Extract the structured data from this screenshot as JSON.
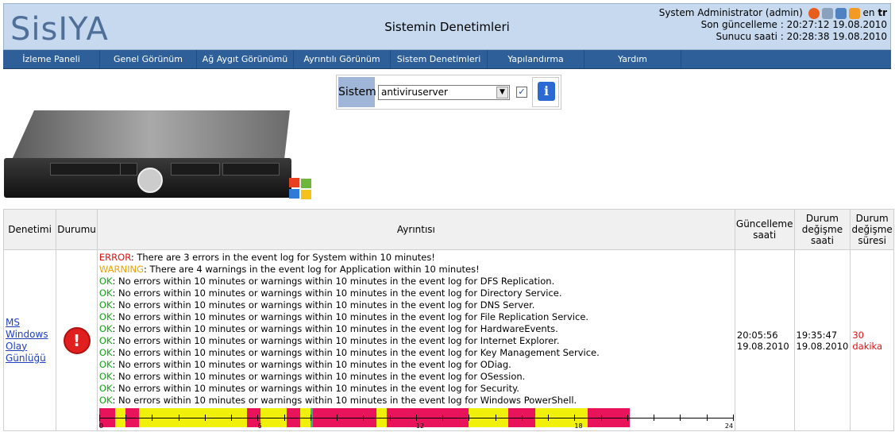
{
  "header": {
    "logo": "SisIYA",
    "title": "Sistemin Denetimleri",
    "user": "System Administrator (admin)",
    "lang_en": "en",
    "lang_tr": "tr",
    "last_update": "Son güncelleme : 20:27:12 19.08.2010",
    "server_time": "Sunucu saati : 20:28:38 19.08.2010",
    "icons": [
      "power-icon",
      "tools-icon",
      "download-icon",
      "rss-icon"
    ]
  },
  "menu": [
    "İzleme Paneli",
    "Genel Görünüm",
    "Ağ Aygıt Görünümü",
    "Ayrıntılı Görünüm",
    "Sistem Denetimleri",
    "Yapılandırma",
    "Yardım"
  ],
  "selector": {
    "label": "Sistem",
    "value": "antiviruserver",
    "checkbox_checked": true,
    "info_icon": "info-icon"
  },
  "table": {
    "headers": [
      "Denetimi",
      "Durumu",
      "Ayrıntısı",
      "Güncelleme saati",
      "Durum değişme saati",
      "Durum değişme süresi"
    ],
    "rows": [
      {
        "check_name": "MS Windows Olay Günlüğü",
        "status_icon": "error-icon",
        "details": [
          {
            "level": "ERROR",
            "text": " There are 3 errors in the event log for System within 10 minutes!"
          },
          {
            "level": "WARNING",
            "text": " There are 4 warnings in the event log for Application within 10 minutes!"
          },
          {
            "level": "OK",
            "text": " No errors within 10 minutes or warnings within 10 minutes in the event log for DFS Replication."
          },
          {
            "level": "OK",
            "text": " No errors within 10 minutes or warnings within 10 minutes in the event log for Directory Service."
          },
          {
            "level": "OK",
            "text": " No errors within 10 minutes or warnings within 10 minutes in the event log for DNS Server."
          },
          {
            "level": "OK",
            "text": " No errors within 10 minutes or warnings within 10 minutes in the event log for File Replication Service."
          },
          {
            "level": "OK",
            "text": " No errors within 10 minutes or warnings within 10 minutes in the event log for HardwareEvents."
          },
          {
            "level": "OK",
            "text": " No errors within 10 minutes or warnings within 10 minutes in the event log for Internet Explorer."
          },
          {
            "level": "OK",
            "text": " No errors within 10 minutes or warnings within 10 minutes in the event log for Key Management Service."
          },
          {
            "level": "OK",
            "text": " No errors within 10 minutes or warnings within 10 minutes in the event log for ODiag."
          },
          {
            "level": "OK",
            "text": " No errors within 10 minutes or warnings within 10 minutes in the event log for OSession."
          },
          {
            "level": "OK",
            "text": " No errors within 10 minutes or warnings within 10 minutes in the event log for Security."
          },
          {
            "level": "OK",
            "text": " No errors within 10 minutes or warnings within 10 minutes in the event log for Windows PowerShell."
          }
        ],
        "update_time": "20:05:56 19.08.2010",
        "change_time": "19:35:47 19.08.2010",
        "change_duration": "30 dakika"
      }
    ]
  },
  "timeline": {
    "hours": [
      0,
      6,
      12,
      18,
      24
    ],
    "colors": {
      "error": "#e8135a",
      "warning": "#f0f00a",
      "ok": "#2bb3a0"
    },
    "segments": [
      {
        "start": 0.0,
        "end": 0.6,
        "state": "error"
      },
      {
        "start": 0.6,
        "end": 1.0,
        "state": "warning"
      },
      {
        "start": 1.0,
        "end": 1.5,
        "state": "error"
      },
      {
        "start": 1.5,
        "end": 5.6,
        "state": "warning"
      },
      {
        "start": 5.6,
        "end": 6.1,
        "state": "error"
      },
      {
        "start": 6.1,
        "end": 7.1,
        "state": "warning"
      },
      {
        "start": 7.1,
        "end": 7.6,
        "state": "error"
      },
      {
        "start": 7.6,
        "end": 8.0,
        "state": "warning"
      },
      {
        "start": 8.0,
        "end": 8.1,
        "state": "ok"
      },
      {
        "start": 8.1,
        "end": 10.5,
        "state": "error"
      },
      {
        "start": 10.5,
        "end": 10.9,
        "state": "warning"
      },
      {
        "start": 10.9,
        "end": 14.0,
        "state": "error"
      },
      {
        "start": 14.0,
        "end": 15.5,
        "state": "warning"
      },
      {
        "start": 15.5,
        "end": 16.5,
        "state": "error"
      },
      {
        "start": 16.5,
        "end": 18.5,
        "state": "warning"
      },
      {
        "start": 18.5,
        "end": 20.1,
        "state": "error"
      }
    ]
  }
}
